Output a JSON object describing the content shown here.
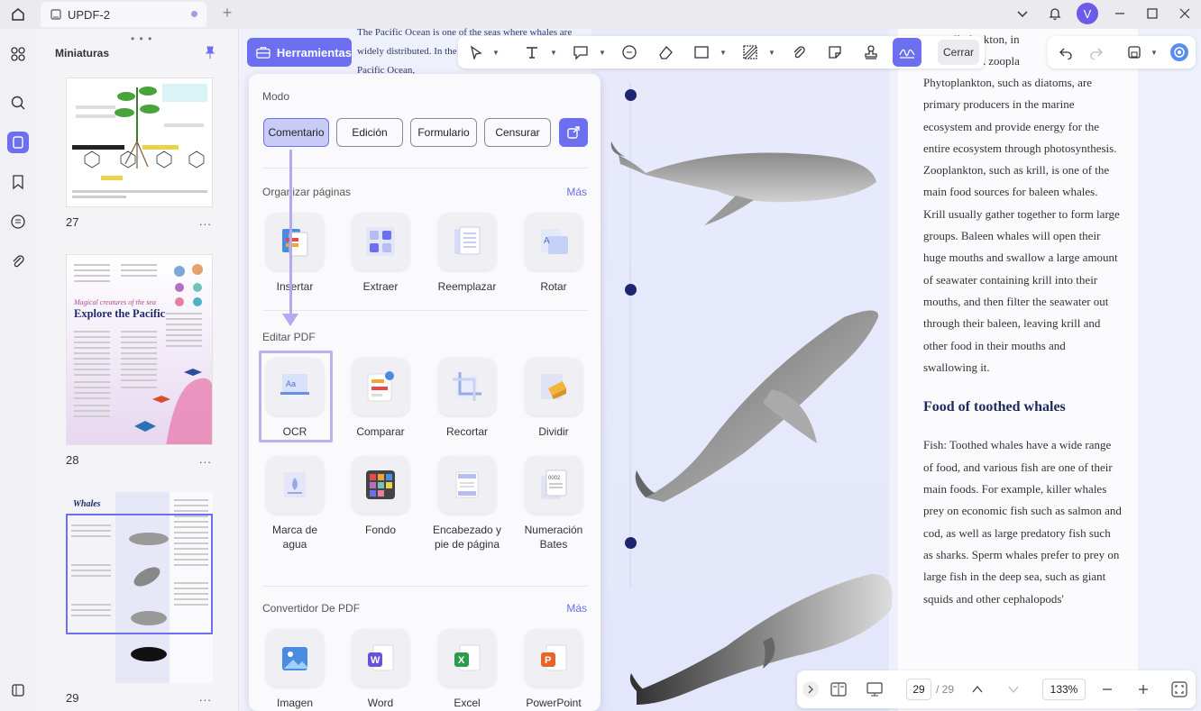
{
  "titlebar": {
    "tab_title": "UPDF-2",
    "new_tab": "+",
    "avatar_letter": "V"
  },
  "thumbnails": {
    "title": "Miniaturas",
    "more": "...",
    "pages": [
      {
        "number": "27"
      },
      {
        "number": "28",
        "heading_small": "Magical creatures of the sea",
        "heading": "Explore the Pacific"
      },
      {
        "number": "29",
        "heading": "Whales"
      }
    ]
  },
  "tools_button": {
    "label": "Herramientas"
  },
  "toolbar": {
    "close_label": "Cerrar"
  },
  "panel": {
    "mode": {
      "title": "Modo",
      "buttons": [
        "Comentario",
        "Edición",
        "Formulario",
        "Censurar"
      ],
      "active": "Comentario"
    },
    "organize": {
      "title": "Organizar páginas",
      "more": "Más",
      "tools": [
        "Insertar",
        "Extraer",
        "Reemplazar",
        "Rotar"
      ]
    },
    "edit": {
      "title": "Editar PDF",
      "tools": [
        "OCR",
        "Comparar",
        "Recortar",
        "Dividir",
        "Marca de agua",
        "Fondo",
        "Encabezado y pie de página",
        "Numeración Bates"
      ]
    },
    "convert": {
      "title": "Convertidor De PDF",
      "more": "Más",
      "tools": [
        "Imagen",
        "Word",
        "Excel",
        "PowerPoint"
      ]
    }
  },
  "document": {
    "top_snippet": "The Pacific Ocean is one of the seas where whales are widely distributed. In the Pacific Ocean, living in the Pacific Ocean,",
    "right_top_lines": [
      "ll plankton, in",
      "on and zoopla"
    ],
    "paragraph1": "Phytoplankton, such as diatoms, are primary producers in the marine ecosystem and provide energy for the entire ecosystem through photosynthesis. Zooplankton, such as krill, is one of the main food sources for baleen whales. Krill usually gather together to form large groups. Baleen whales will open their huge mouths and swallow a large amount of seawater containing krill into their mouths, and then filter the seawater out through their baleen, leaving krill and other food in their mouths and swallowing it.",
    "heading": "Food of toothed whales",
    "paragraph2": "Fish: Toothed whales have a wide range of food, and various fish are one of their main foods. For example, killer whales prey on economic fish such as salmon and cod, as well as large predatory fish such as sharks. Sperm whales prefer to prey on large fish in the deep sea, such as giant squids and other cephalopods'"
  },
  "bottombar": {
    "current_page": "29",
    "total_pages": "/ 29",
    "zoom": "133%"
  },
  "colors": {
    "accent": "#6b6ff0",
    "timeline_dot": "#1f2670",
    "heading": "#1a2a5a"
  }
}
